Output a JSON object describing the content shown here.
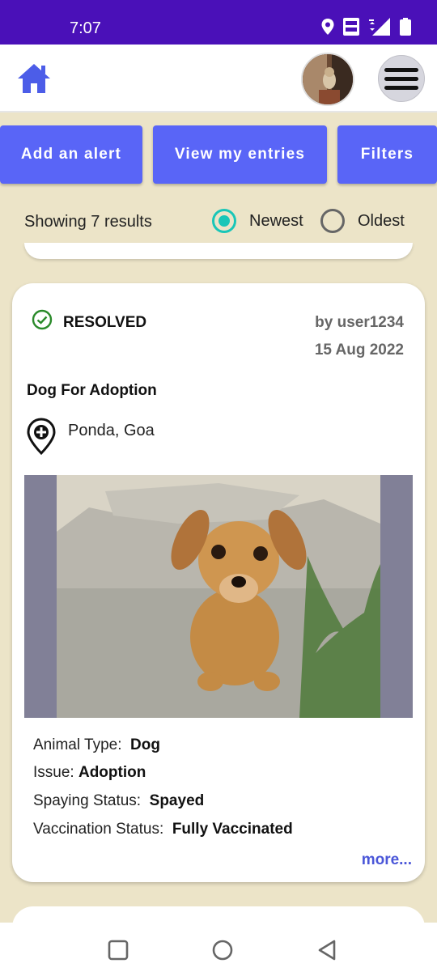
{
  "status_bar": {
    "time": "7:07",
    "icons": [
      "location-icon",
      "volte-icon",
      "signal-4g-icon",
      "battery-icon"
    ]
  },
  "header": {
    "home_icon": "home-icon",
    "avatar": "avatar",
    "menu_icon": "menu-icon"
  },
  "actions": {
    "add_alert": "Add an alert",
    "view_entries": "View my entries",
    "filters": "Filters"
  },
  "results": {
    "count_text": "Showing 7 results",
    "sort_options": [
      "Newest",
      "Oldest"
    ],
    "selected": "Newest"
  },
  "card": {
    "status": "RESOLVED",
    "author": "by user1234",
    "date": "15 Aug 2022",
    "title": "Dog For Adoption",
    "location": "Ponda, Goa",
    "details": [
      {
        "label": "Animal Type:",
        "value": "Dog"
      },
      {
        "label": "Issue:",
        "value": "Adoption"
      },
      {
        "label": "Spaying Status:",
        "value": "Spayed"
      },
      {
        "label": "Vaccination Status:",
        "value": "Fully Vaccinated"
      }
    ],
    "more": "more..."
  },
  "colors": {
    "status_bar": "#4a10b8",
    "accent_button": "#5965f7",
    "radio_selected": "#19c6b8",
    "background": "#ece4c8",
    "link": "#4a56d8",
    "resolved_check": "#2a8a2a"
  }
}
